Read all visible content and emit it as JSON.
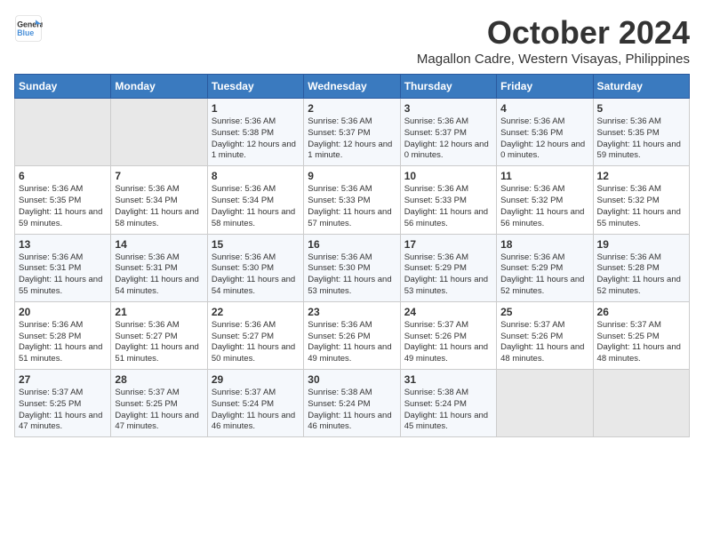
{
  "header": {
    "logo_line1": "General",
    "logo_line2": "Blue",
    "month": "October 2024",
    "location": "Magallon Cadre, Western Visayas, Philippines"
  },
  "days_of_week": [
    "Sunday",
    "Monday",
    "Tuesday",
    "Wednesday",
    "Thursday",
    "Friday",
    "Saturday"
  ],
  "weeks": [
    [
      {
        "day": "",
        "empty": true
      },
      {
        "day": "",
        "empty": true
      },
      {
        "day": "1",
        "sunrise": "5:36 AM",
        "sunset": "5:38 PM",
        "daylight": "12 hours and 1 minute."
      },
      {
        "day": "2",
        "sunrise": "5:36 AM",
        "sunset": "5:37 PM",
        "daylight": "12 hours and 1 minute."
      },
      {
        "day": "3",
        "sunrise": "5:36 AM",
        "sunset": "5:37 PM",
        "daylight": "12 hours and 0 minutes."
      },
      {
        "day": "4",
        "sunrise": "5:36 AM",
        "sunset": "5:36 PM",
        "daylight": "12 hours and 0 minutes."
      },
      {
        "day": "5",
        "sunrise": "5:36 AM",
        "sunset": "5:35 PM",
        "daylight": "11 hours and 59 minutes."
      }
    ],
    [
      {
        "day": "6",
        "sunrise": "5:36 AM",
        "sunset": "5:35 PM",
        "daylight": "11 hours and 59 minutes."
      },
      {
        "day": "7",
        "sunrise": "5:36 AM",
        "sunset": "5:34 PM",
        "daylight": "11 hours and 58 minutes."
      },
      {
        "day": "8",
        "sunrise": "5:36 AM",
        "sunset": "5:34 PM",
        "daylight": "11 hours and 58 minutes."
      },
      {
        "day": "9",
        "sunrise": "5:36 AM",
        "sunset": "5:33 PM",
        "daylight": "11 hours and 57 minutes."
      },
      {
        "day": "10",
        "sunrise": "5:36 AM",
        "sunset": "5:33 PM",
        "daylight": "11 hours and 56 minutes."
      },
      {
        "day": "11",
        "sunrise": "5:36 AM",
        "sunset": "5:32 PM",
        "daylight": "11 hours and 56 minutes."
      },
      {
        "day": "12",
        "sunrise": "5:36 AM",
        "sunset": "5:32 PM",
        "daylight": "11 hours and 55 minutes."
      }
    ],
    [
      {
        "day": "13",
        "sunrise": "5:36 AM",
        "sunset": "5:31 PM",
        "daylight": "11 hours and 55 minutes."
      },
      {
        "day": "14",
        "sunrise": "5:36 AM",
        "sunset": "5:31 PM",
        "daylight": "11 hours and 54 minutes."
      },
      {
        "day": "15",
        "sunrise": "5:36 AM",
        "sunset": "5:30 PM",
        "daylight": "11 hours and 54 minutes."
      },
      {
        "day": "16",
        "sunrise": "5:36 AM",
        "sunset": "5:30 PM",
        "daylight": "11 hours and 53 minutes."
      },
      {
        "day": "17",
        "sunrise": "5:36 AM",
        "sunset": "5:29 PM",
        "daylight": "11 hours and 53 minutes."
      },
      {
        "day": "18",
        "sunrise": "5:36 AM",
        "sunset": "5:29 PM",
        "daylight": "11 hours and 52 minutes."
      },
      {
        "day": "19",
        "sunrise": "5:36 AM",
        "sunset": "5:28 PM",
        "daylight": "11 hours and 52 minutes."
      }
    ],
    [
      {
        "day": "20",
        "sunrise": "5:36 AM",
        "sunset": "5:28 PM",
        "daylight": "11 hours and 51 minutes."
      },
      {
        "day": "21",
        "sunrise": "5:36 AM",
        "sunset": "5:27 PM",
        "daylight": "11 hours and 51 minutes."
      },
      {
        "day": "22",
        "sunrise": "5:36 AM",
        "sunset": "5:27 PM",
        "daylight": "11 hours and 50 minutes."
      },
      {
        "day": "23",
        "sunrise": "5:36 AM",
        "sunset": "5:26 PM",
        "daylight": "11 hours and 49 minutes."
      },
      {
        "day": "24",
        "sunrise": "5:37 AM",
        "sunset": "5:26 PM",
        "daylight": "11 hours and 49 minutes."
      },
      {
        "day": "25",
        "sunrise": "5:37 AM",
        "sunset": "5:26 PM",
        "daylight": "11 hours and 48 minutes."
      },
      {
        "day": "26",
        "sunrise": "5:37 AM",
        "sunset": "5:25 PM",
        "daylight": "11 hours and 48 minutes."
      }
    ],
    [
      {
        "day": "27",
        "sunrise": "5:37 AM",
        "sunset": "5:25 PM",
        "daylight": "11 hours and 47 minutes."
      },
      {
        "day": "28",
        "sunrise": "5:37 AM",
        "sunset": "5:25 PM",
        "daylight": "11 hours and 47 minutes."
      },
      {
        "day": "29",
        "sunrise": "5:37 AM",
        "sunset": "5:24 PM",
        "daylight": "11 hours and 46 minutes."
      },
      {
        "day": "30",
        "sunrise": "5:38 AM",
        "sunset": "5:24 PM",
        "daylight": "11 hours and 46 minutes."
      },
      {
        "day": "31",
        "sunrise": "5:38 AM",
        "sunset": "5:24 PM",
        "daylight": "11 hours and 45 minutes."
      },
      {
        "day": "",
        "empty": true
      },
      {
        "day": "",
        "empty": true
      }
    ]
  ]
}
